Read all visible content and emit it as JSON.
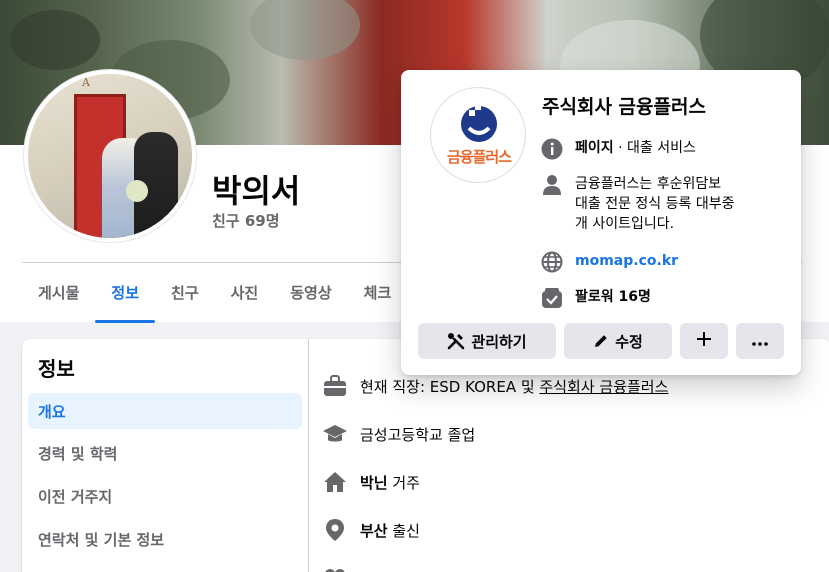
{
  "profile": {
    "name": "박의서",
    "friends": "친구 69명",
    "avatar_sign": "A"
  },
  "tabs": [
    {
      "label": "게시물",
      "active": false
    },
    {
      "label": "정보",
      "active": true
    },
    {
      "label": "친구",
      "active": false
    },
    {
      "label": "사진",
      "active": false
    },
    {
      "label": "동영상",
      "active": false
    },
    {
      "label": "체크",
      "active": false
    }
  ],
  "about": {
    "title": "정보",
    "sidebar": [
      "개요",
      "경력 및 학력",
      "이전 거주지",
      "연락처 및 기본 정보"
    ],
    "work_prefix": "현재 직장: ESD KOREA 및 ",
    "work_link": "주식회사 금융플러스",
    "education": "금성고등학교 졸업",
    "lives_bold": "박닌",
    "lives_suffix": " 거주",
    "from_bold": "부산",
    "from_suffix": " 출신"
  },
  "popup": {
    "page_name": "주식회사 금융플러스",
    "logo_text": "금융플러스",
    "category_bold": "페이지",
    "category_rest": " · 대출 서비스",
    "description": "금융플러스는 후순위담보\n대출 전문 정식 등록 대부중\n개 사이트입니다.",
    "website": "momap.co.kr",
    "followers": "팔로워 16명",
    "manage_label": "관리하기",
    "edit_label": "수정"
  },
  "colors": {
    "accent": "#1b74e4",
    "logo_orange": "#e9692c",
    "logo_navy": "#1f3a8a"
  }
}
